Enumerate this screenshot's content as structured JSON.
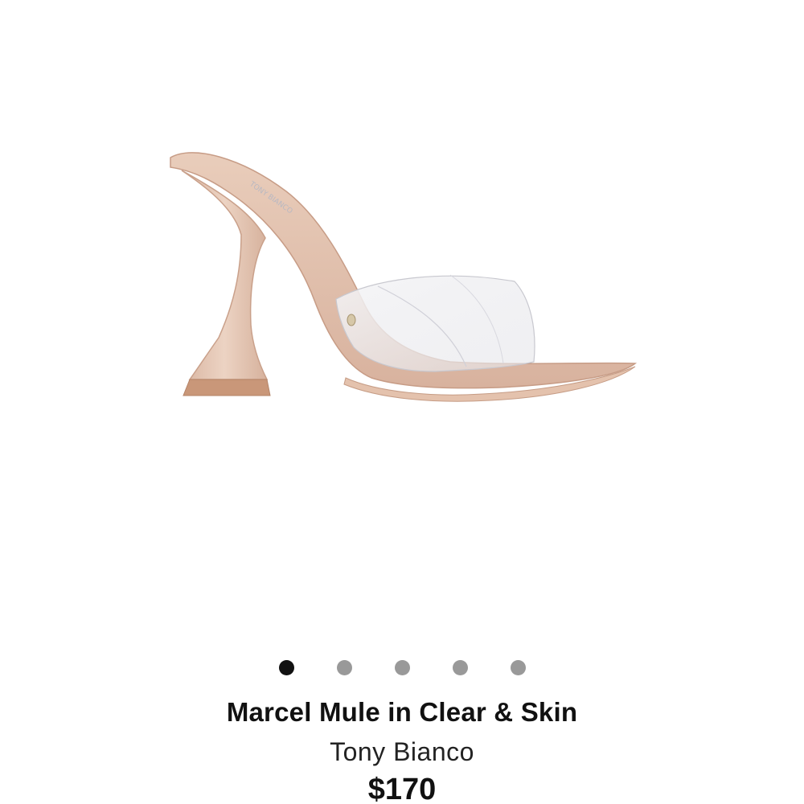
{
  "product": {
    "image_icon": "mule-sandal-photo",
    "title": "Marcel Mule in Clear & Skin",
    "brand": "Tony Bianco",
    "price": "$170"
  },
  "carousel": {
    "total": 5,
    "active_index": 0,
    "colors": {
      "active": "#111111",
      "inactive": "#999999"
    }
  }
}
